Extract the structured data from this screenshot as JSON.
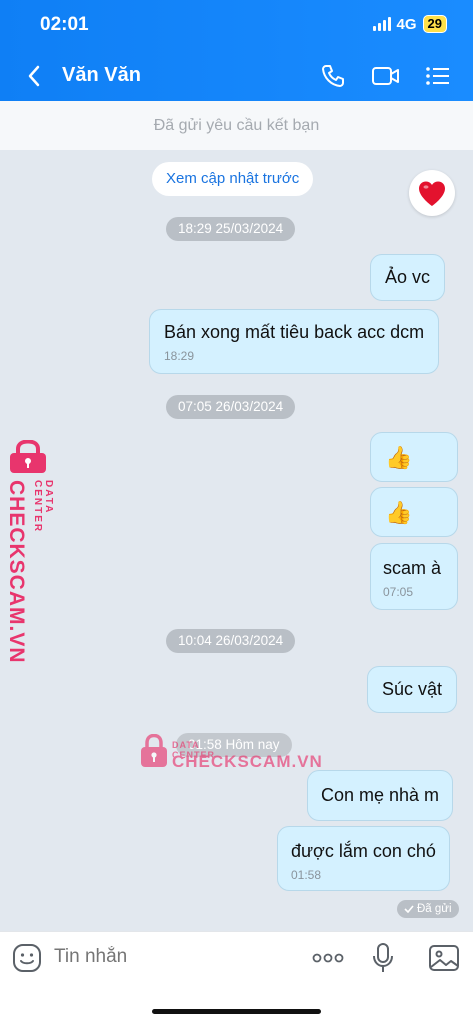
{
  "status_bar": {
    "time": "02:01",
    "network": "4G",
    "battery": "29"
  },
  "header": {
    "title": "Văn Văn"
  },
  "friend_request": {
    "text": "Đã gửi yêu cầu kết bạn"
  },
  "chat": {
    "load_more": "Xem cập nhật trước",
    "timestamps": [
      "18:29 25/03/2024",
      "07:05 26/03/2024",
      "10:04 26/03/2024",
      "01:58 Hôm nay"
    ],
    "messages": [
      {
        "text": "Ảo vc",
        "time": ""
      },
      {
        "text": "Bán xong mất tiêu back acc dcm",
        "time": "18:29"
      },
      {
        "text": "👍",
        "time": ""
      },
      {
        "text": "👍",
        "time": ""
      },
      {
        "text": "scam à",
        "time": "07:05"
      },
      {
        "text": "Súc vật",
        "time": ""
      },
      {
        "text": "Con mẹ nhà m",
        "time": ""
      },
      {
        "text": "được lắm con chó",
        "time": "01:58"
      }
    ],
    "sent_status": "Đã gửi"
  },
  "watermark": {
    "brand": "CHECKSCAM.VN",
    "subtitle": "DATA CENTER"
  },
  "composer": {
    "placeholder": "Tin nhắn"
  },
  "colors": {
    "header": "#1a8cff",
    "bubble": "#d4f1ff",
    "background": "#e2e8ef",
    "watermark": "#e8356d",
    "link": "#1a74e0"
  }
}
